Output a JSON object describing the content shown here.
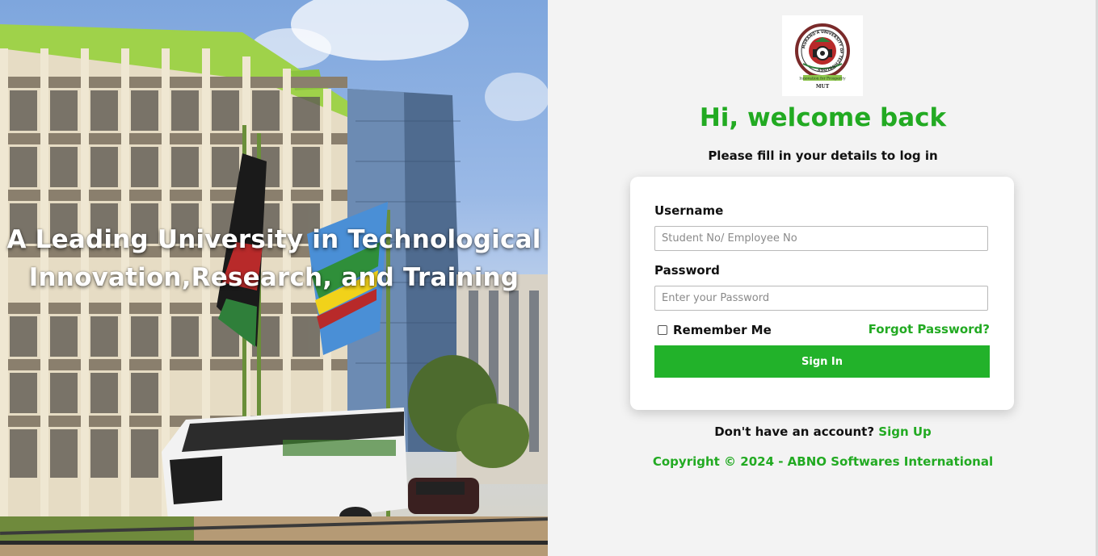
{
  "hero": {
    "tagline_line1": "A Leading University in Technological",
    "tagline_line2": "Innovation,Research, and Training"
  },
  "logo": {
    "ring_text": "MURANG'A UNIVERSITY OF TECHNOLOGY",
    "motto": "Innovation for Prosperity",
    "abbr": "MUT"
  },
  "header": {
    "welcome": "Hi, welcome back",
    "subtitle": "Please fill in your details to log in"
  },
  "form": {
    "username_label": "Username",
    "username_placeholder": "Student No/ Employee No",
    "username_value": "",
    "password_label": "Password",
    "password_placeholder": "Enter your Password",
    "password_value": "",
    "remember_label": "Remember Me",
    "remember_checked": false,
    "forgot_label": "Forgot Password?",
    "signin_label": "Sign In"
  },
  "footer": {
    "signup_prompt": "Don't have an account?",
    "signup_link": "Sign Up",
    "copyright": "Copyright © 2024 - ABNO Softwares International"
  },
  "colors": {
    "accent_green": "#22aa22",
    "button_green": "#22b22a",
    "panel_bg": "#f3f3f3"
  }
}
